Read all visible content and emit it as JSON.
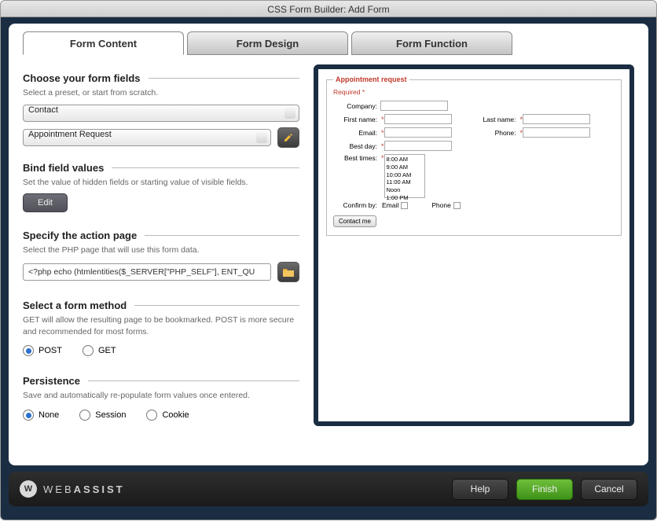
{
  "window": {
    "title": "CSS Form Builder: Add Form"
  },
  "tabs": {
    "content": "Form Content",
    "design": "Form Design",
    "function": "Form Function"
  },
  "fields": {
    "head": "Choose your form fields",
    "sub": "Select a preset, or start from scratch.",
    "preset1": "Contact",
    "preset2": "Appointment Request"
  },
  "bind": {
    "head": "Bind field values",
    "sub": "Set the value of hidden fields or starting value of visible fields.",
    "edit": "Edit"
  },
  "action": {
    "head": "Specify the action page",
    "sub": "Select the PHP page that will use this form data.",
    "value": "<?php echo (htmlentities($_SERVER[\"PHP_SELF\"], ENT_QU"
  },
  "method": {
    "head": "Select a form method",
    "sub": "GET will allow the resulting page to be bookmarked. POST is more secure and recommended for most forms.",
    "post": "POST",
    "get": "GET"
  },
  "persist": {
    "head": "Persistence",
    "sub": "Save and automatically re-populate form values once entered.",
    "none": "None",
    "session": "Session",
    "cookie": "Cookie"
  },
  "preview": {
    "legend": "Appointment request",
    "required": "Required *",
    "company": "Company:",
    "first": "First name:",
    "last": "Last name:",
    "email": "Email:",
    "phone": "Phone:",
    "bestday": "Best day:",
    "besttimes": "Best times:",
    "times": [
      "8:00 AM",
      "9:00 AM",
      "10:00 AM",
      "11:00 AM",
      "Noon",
      "1:00 PM"
    ],
    "confirm": "Confirm by:",
    "confirm_email": "Email",
    "confirm_phone": "Phone",
    "submit": "Contact me"
  },
  "brand": {
    "light": "WEB",
    "bold": "ASSIST"
  },
  "footer": {
    "help": "Help",
    "finish": "Finish",
    "cancel": "Cancel"
  }
}
